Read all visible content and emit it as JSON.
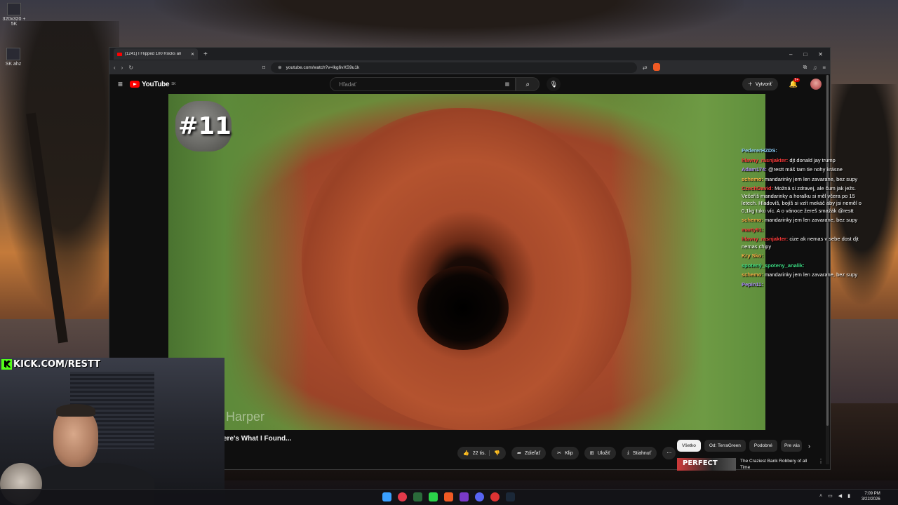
{
  "desktop": {
    "icon1_label": "320x320 + 5K",
    "icon2_label": "SK ahz"
  },
  "browser": {
    "tab_title": "(1241) I Flipped 100 Rocks an",
    "new_tab": "+",
    "url": "youtube.com/watch?v=lkg6vXS9u1k",
    "controls": {
      "minimize": "–",
      "maximize": "□",
      "close": "✕"
    }
  },
  "youtube": {
    "logo_text": "YouTube",
    "logo_region": "SK",
    "search_placeholder": "Hľadať",
    "create_label": "Vytvoriť",
    "notif_count": "9+",
    "video": {
      "rank_label": "#11",
      "watermark": "Harper"
    },
    "video_title": "ere's What I Found...",
    "actions": {
      "like_count": "22 tis.",
      "share": "Zdieľať",
      "clip": "Klip",
      "save": "Uložiť",
      "download": "Stiahnuť"
    },
    "chips": [
      "Všetko",
      "Od: TerraGreen",
      "Podobné",
      "Pre vás"
    ],
    "recommendation": {
      "thumb_text": "PERFECT",
      "title": "The Craziest Bank Robbery of all Time"
    }
  },
  "chat": [
    {
      "user": "PedererHZDS:",
      "color": "#8fd3ff",
      "text": ""
    },
    {
      "user": "hlavny_rasnjakter:",
      "color": "#ff3b3b",
      "text": "djt donald jay trump"
    },
    {
      "user": "Adam174:",
      "color": "#b08cff",
      "text": "@restt máš tam tie nohy krásne"
    },
    {
      "user": "schemo:",
      "color": "#ffb347",
      "text": "mandarinky jem len zavarane, bez supy"
    },
    {
      "user": "CzechDavid:",
      "color": "#ff3b3b",
      "text": "Možná si zdravej, ale čum jak ježs. Večeříš mandarinky a horalku si měl včera po 15 letech. Hladovíš, bojíš si vzít mekáč aby jsi neměl o 0,1kg tuku víc. A o vánoce žereš smažák @restt"
    },
    {
      "user": "schemo:",
      "color": "#ffb347",
      "text": "mandarinky jem len zavarane, bez supy"
    },
    {
      "user": "marty91:",
      "color": "#ff3b3b",
      "text": ""
    },
    {
      "user": "hlavny_rasnjakter:",
      "color": "#ff3b3b",
      "text": "cize ak nemas v sebe dost djt nemas chipy"
    },
    {
      "user": "Kry Sko:",
      "color": "#ffb347",
      "text": ""
    },
    {
      "user": "spotený_spoteny_analik:",
      "color": "#3ddc84",
      "text": ""
    },
    {
      "user": "schemo:",
      "color": "#ffb347",
      "text": "mandarinky jem len zavarane, bez supy"
    },
    {
      "user": "Pepin11:",
      "color": "#b08cff",
      "text": ""
    }
  ],
  "stream": {
    "kick_url": "KICK.COM/RESTT"
  },
  "taskbar": {
    "time": "7:09 PM",
    "date": "3/22/2026"
  },
  "colors": {
    "youtube_red": "#ff0000",
    "kick_green": "#53fc18"
  }
}
